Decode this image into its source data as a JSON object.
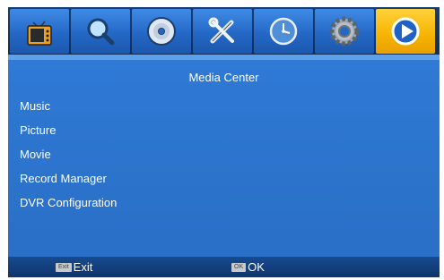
{
  "top_tabs": [
    {
      "icon": "tv-icon",
      "active": false
    },
    {
      "icon": "search-icon",
      "active": false
    },
    {
      "icon": "disc-icon",
      "active": false
    },
    {
      "icon": "tools-icon",
      "active": false
    },
    {
      "icon": "clock-icon",
      "active": false
    },
    {
      "icon": "gear-icon",
      "active": false
    },
    {
      "icon": "play-icon",
      "active": true
    }
  ],
  "page": {
    "title": "Media Center"
  },
  "menu": {
    "items": [
      {
        "label": "Music"
      },
      {
        "label": "Picture"
      },
      {
        "label": "Movie"
      },
      {
        "label": "Record Manager"
      },
      {
        "label": "DVR Configuration"
      }
    ]
  },
  "footer": {
    "exit_key": "Exit",
    "exit_label": "Exit",
    "ok_key": "OK",
    "ok_label": "OK"
  },
  "colors": {
    "background": "#2a6fc8",
    "active_tab": "#f5b400",
    "tab": "#2468c6"
  }
}
